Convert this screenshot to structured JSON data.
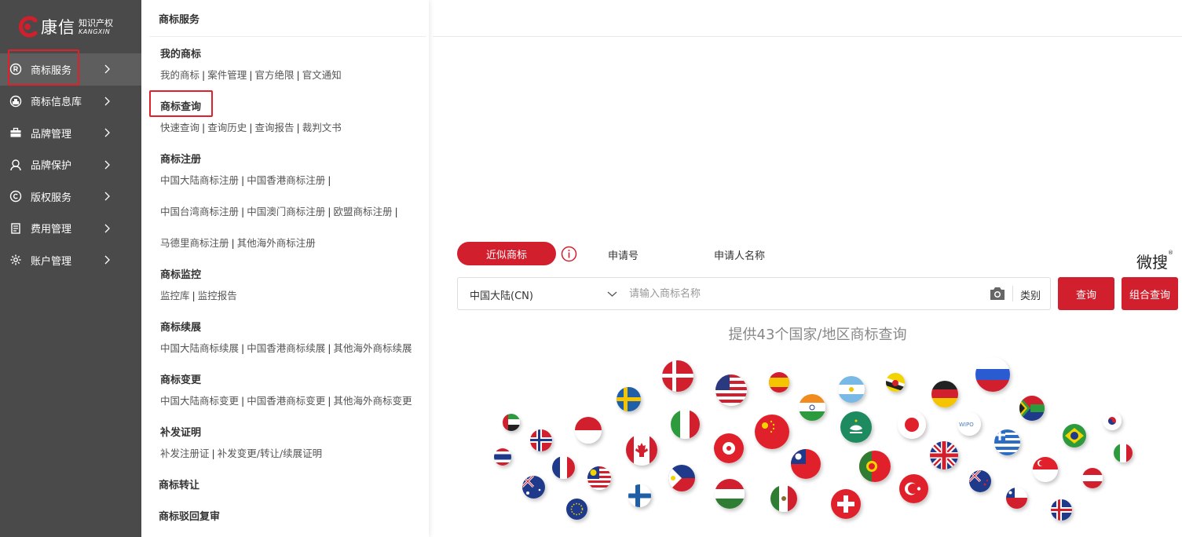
{
  "logo": {
    "cn": "康信",
    "sub_cn": "知识产权",
    "sub_en": "KANGXIN"
  },
  "sidebar": {
    "items": [
      {
        "label": "商标服务",
        "icon": "registered-icon"
      },
      {
        "label": "商标信息库",
        "icon": "database-icon"
      },
      {
        "label": "品牌管理",
        "icon": "briefcase-icon"
      },
      {
        "label": "品牌保护",
        "icon": "user-shield-icon"
      },
      {
        "label": "版权服务",
        "icon": "copyright-icon"
      },
      {
        "label": "费用管理",
        "icon": "receipt-icon"
      },
      {
        "label": "账户管理",
        "icon": "gear-icon"
      }
    ]
  },
  "panel": {
    "title": "商标服务",
    "sections": [
      {
        "heading": "我的商标",
        "rows": [
          [
            "我的商标",
            "案件管理",
            "官方绝限",
            "官文通知"
          ]
        ]
      },
      {
        "heading": "商标查询",
        "rows": [
          [
            "快速查询",
            "查询历史",
            "查询报告",
            "裁判文书"
          ]
        ]
      },
      {
        "heading": "商标注册",
        "rows": [
          [
            "中国大陆商标注册",
            "中国香港商标注册",
            ""
          ],
          [
            "中国台湾商标注册",
            "中国澳门商标注册",
            "欧盟商标注册",
            ""
          ],
          [
            "马德里商标注册",
            "其他海外商标注册"
          ]
        ]
      },
      {
        "heading": "商标监控",
        "rows": [
          [
            "监控库",
            "监控报告"
          ]
        ]
      },
      {
        "heading": "商标续展",
        "rows": [
          [
            "中国大陆商标续展",
            "中国香港商标续展",
            "其他海外商标续展"
          ]
        ]
      },
      {
        "heading": "商标变更",
        "rows": [
          [
            "中国大陆商标变更",
            "中国香港商标变更",
            "其他海外商标变更"
          ]
        ]
      },
      {
        "heading": "补发证明",
        "rows": [
          [
            "补发注册证",
            "补发变更/转让/续展证明"
          ]
        ]
      },
      {
        "heading": "商标转让",
        "rows": []
      },
      {
        "heading": "商标驳回复审",
        "rows": []
      }
    ]
  },
  "search": {
    "tabs": [
      "近似商标",
      "申请号",
      "申请人名称"
    ],
    "brand": "微搜",
    "brand_mark": "®",
    "region": "中国大陆(CN)",
    "placeholder": "请输入商标名称",
    "category": "类别",
    "query_button": "查询",
    "combo_button": "组合查询",
    "headline": "提供43个国家/地区商标查询"
  },
  "colors": {
    "accent": "#d11f2e",
    "sidebar": "#4a4a4a"
  }
}
